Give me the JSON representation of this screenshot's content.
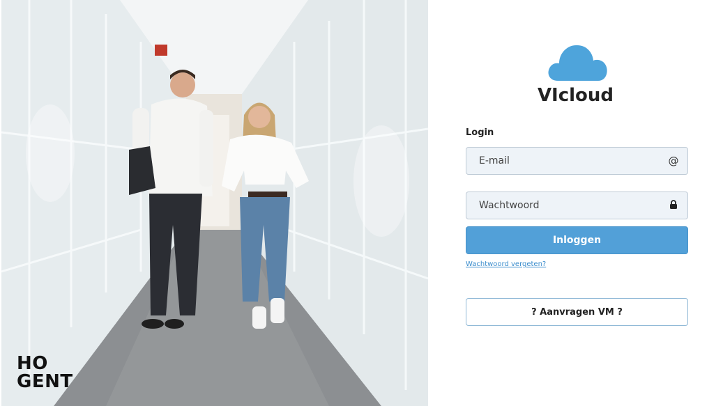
{
  "branding": {
    "logo_line1": "HO",
    "logo_line2": "GENT"
  },
  "app": {
    "name": "VIcloud",
    "logo_icon": "cloud-icon",
    "accent_color": "#52a0d8"
  },
  "login": {
    "heading": "Login",
    "email_placeholder": "E-mail",
    "email_icon": "@",
    "password_placeholder": "Wachtwoord",
    "password_icon": "lock-icon",
    "submit_label": "Inloggen",
    "forgot_label": "Wachtwoord vergeten?",
    "request_vm_label": "? Aanvragen VM ?"
  }
}
